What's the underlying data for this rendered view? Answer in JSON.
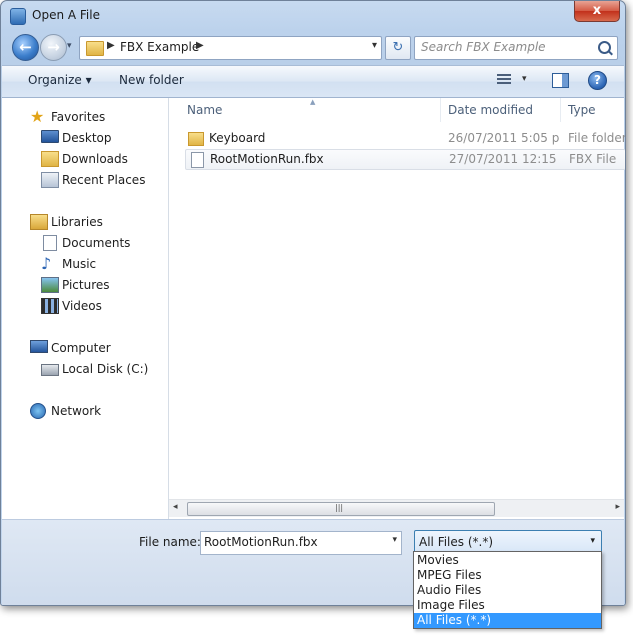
{
  "window": {
    "title": "Open A File",
    "close_label": "x"
  },
  "navigation": {
    "back_label": "←",
    "forward_label": "→",
    "address": {
      "crumb_separator": "▶",
      "path_label": "FBX Example",
      "dropdown": "▾"
    },
    "refresh_label": "↻",
    "search": {
      "placeholder": "Search FBX Example"
    }
  },
  "toolbar": {
    "organize_label": "Organize ▾",
    "new_folder_label": "New folder",
    "views_dropdown": "▾",
    "help_label": "?"
  },
  "sidebar": {
    "groups": [
      {
        "label": "Favorites",
        "icon": "star-icon",
        "items": [
          {
            "label": "Desktop",
            "icon": "desktop-icon"
          },
          {
            "label": "Downloads",
            "icon": "downloads-folder-icon"
          },
          {
            "label": "Recent Places",
            "icon": "recent-places-icon"
          }
        ]
      },
      {
        "label": "Libraries",
        "icon": "libraries-icon",
        "items": [
          {
            "label": "Documents",
            "icon": "documents-icon"
          },
          {
            "label": "Music",
            "icon": "music-icon"
          },
          {
            "label": "Pictures",
            "icon": "pictures-icon"
          },
          {
            "label": "Videos",
            "icon": "videos-icon"
          }
        ]
      },
      {
        "label": "Computer",
        "icon": "computer-icon",
        "items": [
          {
            "label": "Local Disk (C:)",
            "icon": "local-disk-icon"
          }
        ]
      },
      {
        "label": "Network",
        "icon": "network-icon",
        "items": []
      }
    ]
  },
  "file_list": {
    "columns": [
      "Name",
      "Date modified",
      "Type"
    ],
    "sort_indicator": "▲",
    "rows": [
      {
        "name": "Keyboard",
        "date": "26/07/2011 5:05 p....",
        "type": "File folder",
        "icon": "folder-icon"
      },
      {
        "name": "RootMotionRun.fbx",
        "date": "27/07/2011 12:15 a...",
        "type": "FBX File",
        "icon": "file-icon"
      }
    ],
    "scrollbar": {
      "left_arrow": "◂",
      "right_arrow": "▸",
      "grip": "|||"
    }
  },
  "footer": {
    "file_name_label": "File name:",
    "file_name_value": "RootMotionRun.fbx",
    "file_name_dropdown": "▾",
    "filter_value": "All Files (*.*)",
    "filter_dropdown": "▾",
    "filter_options": [
      "Movies",
      "MPEG Files",
      "Audio Files",
      "Image Files",
      "All Files (*.*)"
    ],
    "selected_filter_index": 4
  },
  "colors": {
    "selection": "#3399ff",
    "window_chrome": "#c2d6ee",
    "close_button": "#c2301b"
  }
}
